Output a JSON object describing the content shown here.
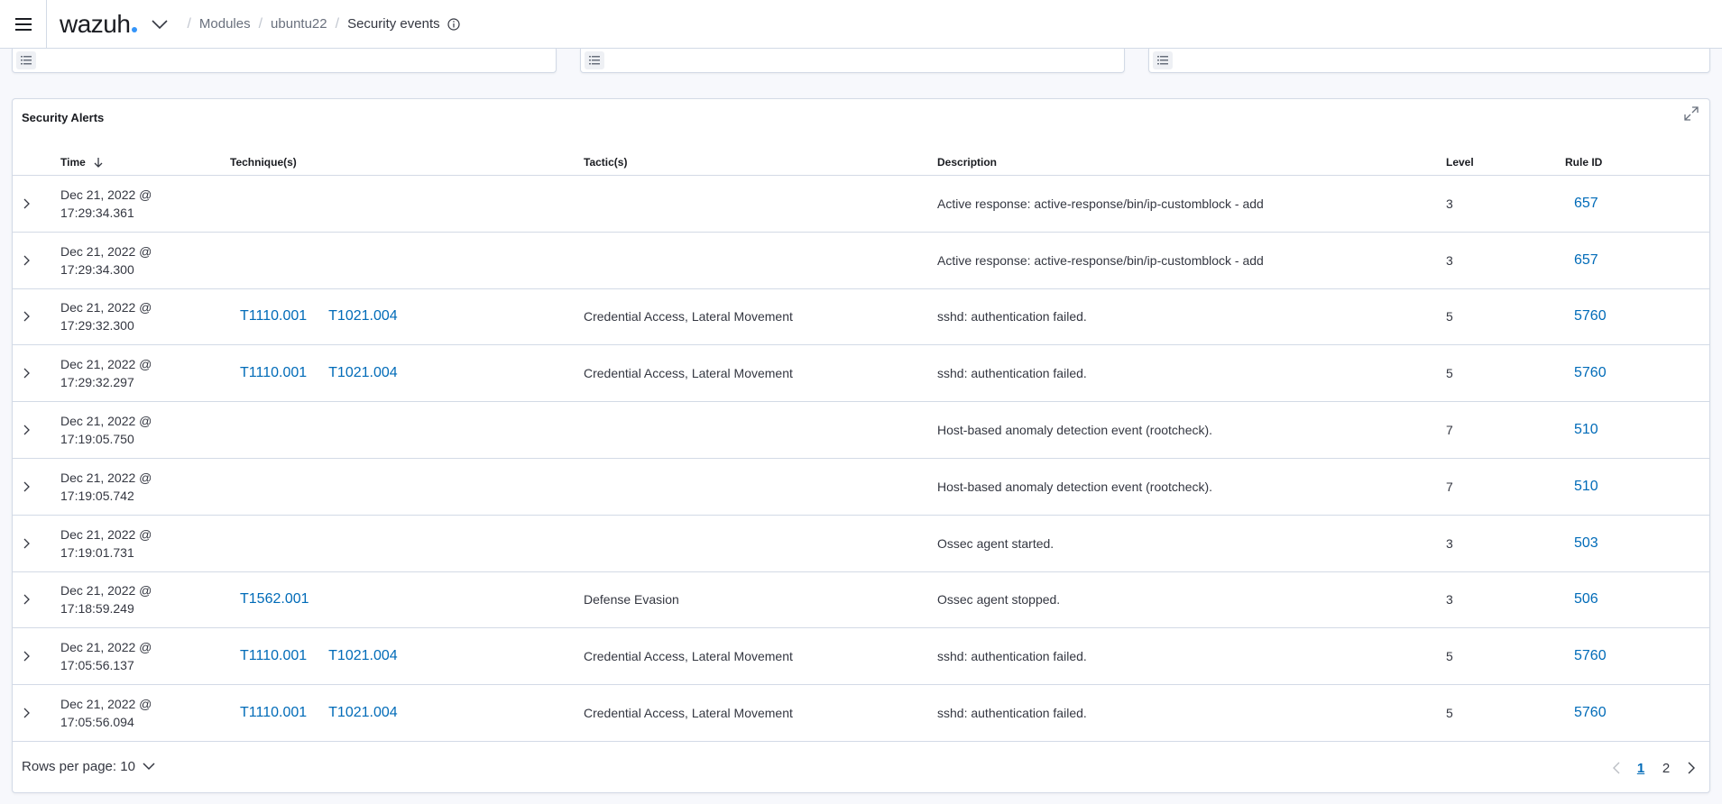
{
  "header": {
    "logo_text": "wazuh",
    "breadcrumbs": [
      "Modules",
      "ubuntu22",
      "Security events"
    ]
  },
  "alerts": {
    "title": "Security Alerts",
    "columns": {
      "time": "Time",
      "techniques": "Technique(s)",
      "tactics": "Tactic(s)",
      "description": "Description",
      "level": "Level",
      "rule_id": "Rule ID"
    },
    "rows": [
      {
        "date": "Dec 21, 2022 @",
        "time": "17:29:34.361",
        "tech1": "",
        "tech2": "",
        "tactics": "",
        "description": "Active response: active-response/bin/ip-customblock - add",
        "level": "3",
        "rule_id": "657"
      },
      {
        "date": "Dec 21, 2022 @",
        "time": "17:29:34.300",
        "tech1": "",
        "tech2": "",
        "tactics": "",
        "description": "Active response: active-response/bin/ip-customblock - add",
        "level": "3",
        "rule_id": "657"
      },
      {
        "date": "Dec 21, 2022 @",
        "time": "17:29:32.300",
        "tech1": "T1110.001",
        "tech2": "T1021.004",
        "tactics": "Credential Access, Lateral Movement",
        "description": "sshd: authentication failed.",
        "level": "5",
        "rule_id": "5760"
      },
      {
        "date": "Dec 21, 2022 @",
        "time": "17:29:32.297",
        "tech1": "T1110.001",
        "tech2": "T1021.004",
        "tactics": "Credential Access, Lateral Movement",
        "description": "sshd: authentication failed.",
        "level": "5",
        "rule_id": "5760"
      },
      {
        "date": "Dec 21, 2022 @",
        "time": "17:19:05.750",
        "tech1": "",
        "tech2": "",
        "tactics": "",
        "description": "Host-based anomaly detection event (rootcheck).",
        "level": "7",
        "rule_id": "510"
      },
      {
        "date": "Dec 21, 2022 @",
        "time": "17:19:05.742",
        "tech1": "",
        "tech2": "",
        "tactics": "",
        "description": "Host-based anomaly detection event (rootcheck).",
        "level": "7",
        "rule_id": "510"
      },
      {
        "date": "Dec 21, 2022 @",
        "time": "17:19:01.731",
        "tech1": "",
        "tech2": "",
        "tactics": "",
        "description": "Ossec agent started.",
        "level": "3",
        "rule_id": "503"
      },
      {
        "date": "Dec 21, 2022 @",
        "time": "17:18:59.249",
        "tech1": "T1562.001",
        "tech2": "",
        "tactics": "Defense Evasion",
        "description": "Ossec agent stopped.",
        "level": "3",
        "rule_id": "506"
      },
      {
        "date": "Dec 21, 2022 @",
        "time": "17:05:56.137",
        "tech1": "T1110.001",
        "tech2": "T1021.004",
        "tactics": "Credential Access, Lateral Movement",
        "description": "sshd: authentication failed.",
        "level": "5",
        "rule_id": "5760"
      },
      {
        "date": "Dec 21, 2022 @",
        "time": "17:05:56.094",
        "tech1": "T1110.001",
        "tech2": "T1021.004",
        "tactics": "Credential Access, Lateral Movement",
        "description": "sshd: authentication failed.",
        "level": "5",
        "rule_id": "5760"
      }
    ],
    "footer": {
      "rows_per_page": "Rows per page: 10",
      "pages": [
        "1",
        "2"
      ]
    }
  },
  "colors": {
    "link": "#006bb8",
    "border": "#d3dae6",
    "logo_dot": "#3595f9"
  }
}
